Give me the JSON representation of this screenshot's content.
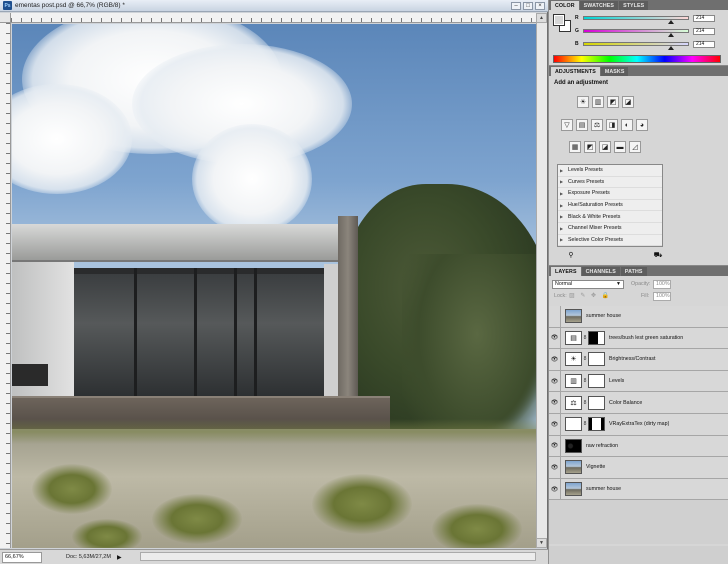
{
  "document": {
    "title": "ementas post.psd @ 66,7% (RGB/8) *",
    "ps_icon_label": "Ps",
    "window_buttons": {
      "minimize": "–",
      "maximize": "□",
      "close": "×"
    },
    "zoom": "66,67%",
    "doc_info": "Doc: 5,63M/27,2M",
    "status_arrow": "▶",
    "scroll_up": "▲",
    "scroll_down": "▼"
  },
  "color_panel": {
    "tabs": [
      "COLOR",
      "SWATCHES",
      "STYLES"
    ],
    "channels": [
      {
        "label": "R",
        "value": "214",
        "gradient": "linear-gradient(90deg,#00d6d6,#ffd6d6)",
        "fraction": 0.84
      },
      {
        "label": "G",
        "value": "214",
        "gradient": "linear-gradient(90deg,#d600d6,#d6ffd6)",
        "fraction": 0.84
      },
      {
        "label": "B",
        "value": "214",
        "gradient": "linear-gradient(90deg,#d6d600,#d6d6ff)",
        "fraction": 0.84
      }
    ],
    "foreground_color": "#d6d6d6",
    "background_color": "#ffffff"
  },
  "adjustments_panel": {
    "tabs": [
      "ADJUSTMENTS",
      "MASKS"
    ],
    "heading": "Add an adjustment",
    "icon_rows": [
      [
        "☀",
        "▥",
        "◩",
        "◪"
      ],
      [
        "▽",
        "▤",
        "⚖",
        "◨",
        "◐",
        "◕"
      ],
      [
        "▦",
        "◩",
        "◪",
        "▬",
        "◿"
      ]
    ],
    "icon_names": [
      [
        "brightness-contrast-icon",
        "levels-icon",
        "curves-icon",
        "exposure-icon"
      ],
      [
        "vibrance-icon",
        "hue-saturation-icon",
        "color-balance-icon",
        "black-white-icon",
        "photo-filter-icon",
        "channel-mixer-icon"
      ],
      [
        "invert-icon",
        "posterize-icon",
        "threshold-icon",
        "gradient-map-icon",
        "selective-color-icon"
      ]
    ],
    "presets": [
      "Levels Presets",
      "Curves Presets",
      "Exposure Presets",
      "Hue/Saturation Presets",
      "Black & White Presets",
      "Channel Mixer Presets",
      "Selective Color Presets"
    ],
    "preset_arrow": "▶",
    "footer_icons": {
      "left": "⚲",
      "right": "⛟"
    }
  },
  "layers_panel": {
    "tabs": [
      "LAYERS",
      "CHANNELS",
      "PATHS"
    ],
    "blend_mode": "Normal",
    "blend_arrow": "▼",
    "opacity_label": "Opacity:",
    "opacity_value": "100%",
    "lock_label": "Lock:",
    "lock_icons": "▨ ✎ ✥ 🔒",
    "fill_label": "Fill:",
    "fill_value": "100%",
    "eye_glyph": "👁",
    "link_glyph": "8",
    "layers": [
      {
        "name": "summer house",
        "visible": false,
        "thumb": "photo",
        "mask": null,
        "adj_glyph": ""
      },
      {
        "name": "trees/bush lest green saturation",
        "visible": true,
        "thumb": "adj",
        "mask": "tree",
        "adj_glyph": "▤"
      },
      {
        "name": "Brightness/Contrast",
        "visible": true,
        "thumb": "adj",
        "mask": "white",
        "adj_glyph": "☀"
      },
      {
        "name": "Levels",
        "visible": true,
        "thumb": "adj",
        "mask": "white",
        "adj_glyph": "▥"
      },
      {
        "name": "Color Balance",
        "visible": true,
        "thumb": "adj",
        "mask": "white",
        "adj_glyph": "⚖"
      },
      {
        "name": "VRayExtraTex (dirty map)",
        "visible": true,
        "thumb": "white",
        "mask": "dirty",
        "adj_glyph": ""
      },
      {
        "name": "raw refraction",
        "visible": true,
        "thumb": "raw",
        "mask": null,
        "adj_glyph": ""
      },
      {
        "name": "Vignette",
        "visible": true,
        "thumb": "photo",
        "mask": null,
        "adj_glyph": ""
      },
      {
        "name": "summer house",
        "visible": true,
        "thumb": "photo",
        "mask": null,
        "adj_glyph": ""
      }
    ]
  }
}
